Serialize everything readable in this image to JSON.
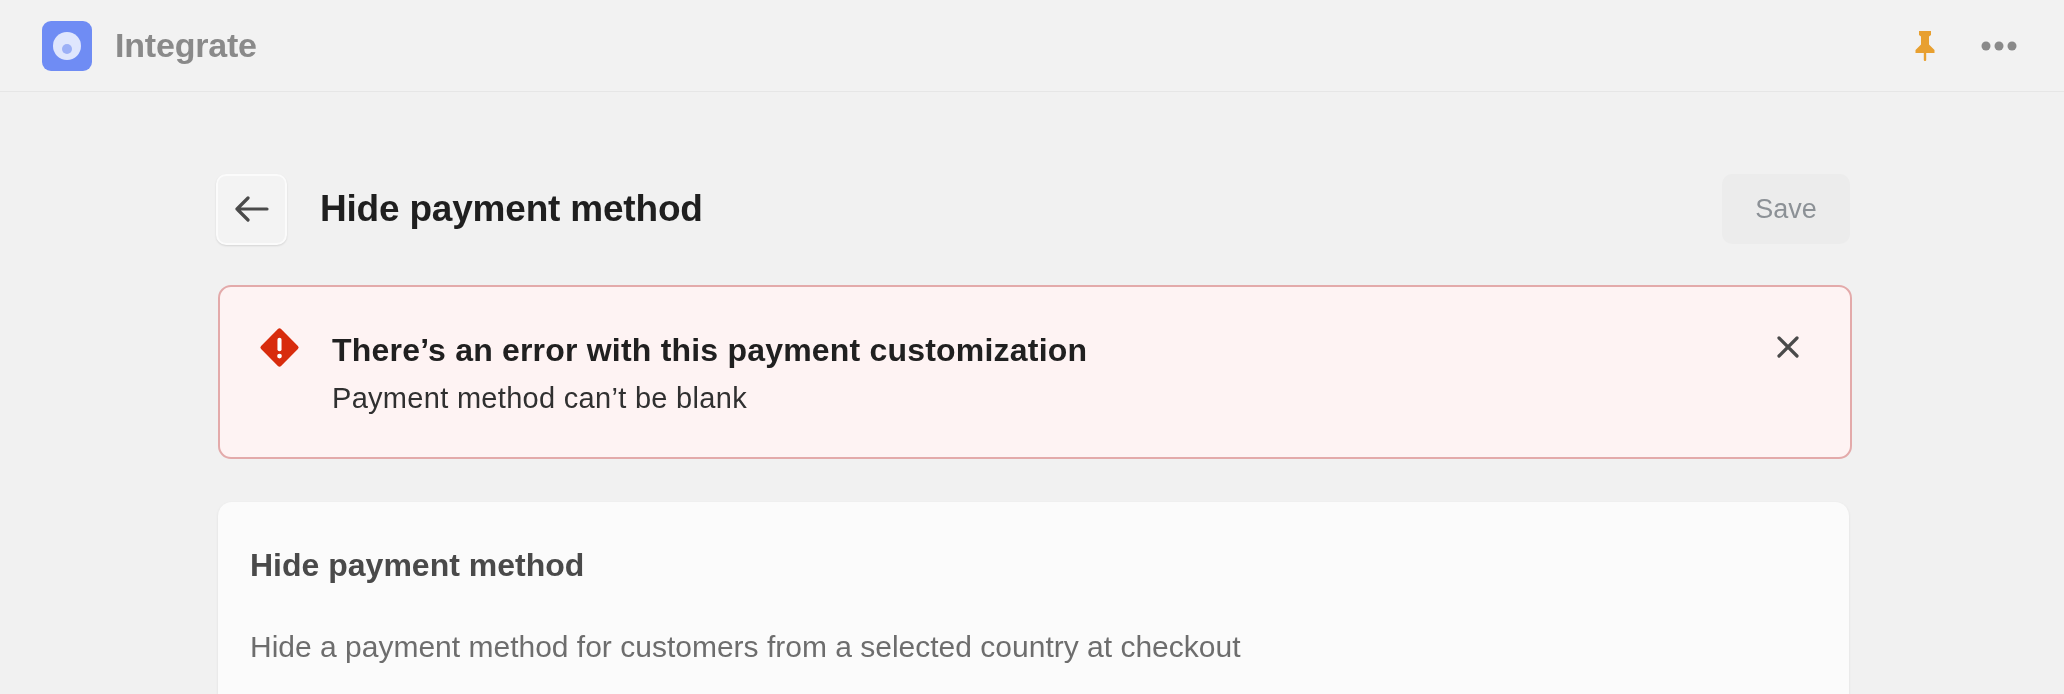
{
  "app_bar": {
    "app_name": "Integrate"
  },
  "page": {
    "title": "Hide payment method",
    "save_button": {
      "label": "Save",
      "disabled": true
    }
  },
  "banner": {
    "kind": "critical",
    "title": "There’s an error with this payment customization",
    "message": "Payment method can’t be blank"
  },
  "card": {
    "title": "Hide payment method",
    "description": "Hide a payment method for customers from a selected country at checkout"
  }
}
